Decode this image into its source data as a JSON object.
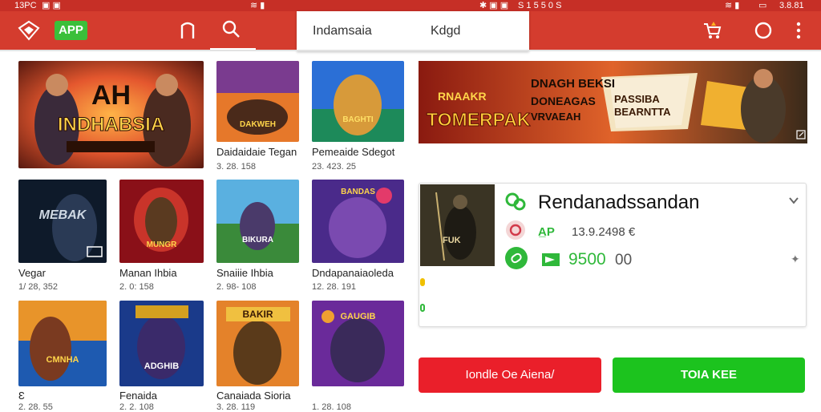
{
  "status_bar": {
    "left_time": "13PC",
    "center_time": "S 1 5 5 0 S",
    "right_time": "3.8.81"
  },
  "app_bar": {
    "app_badge": "APP",
    "menu": {
      "option_primary": "Indamsaia",
      "option_secondary": "Kdgd"
    }
  },
  "featured": {
    "title_line1": "AH",
    "title_line2": "INDHABSIA"
  },
  "grid": [
    {
      "title": "Daidaidaie Tegan",
      "meta": "3. 28. 158",
      "art_text": "DAKWEH"
    },
    {
      "title": "Pemeaide Sdegot",
      "meta": "23. 423. 25",
      "art_text": "BAGHTI"
    },
    {
      "title": "Vegar",
      "meta": "1/ 28, 352",
      "art_text": "MEBAK"
    },
    {
      "title": "Manan Ihbia",
      "meta": "2. 0: 158",
      "art_text": "MUNGR"
    },
    {
      "title": "Snaiiie Ihbia",
      "meta": "2. 98- 108",
      "art_text": "BIKURA"
    },
    {
      "title": "Dndapanaiaoleda",
      "meta": "12. 28. 191",
      "art_text": "BANDAS"
    },
    {
      "title": "Ɛ",
      "meta": "2. 28. 55",
      "art_text": "CMNHA"
    },
    {
      "title": "Fenaida",
      "meta": "2. 2. 108",
      "art_text": "ADGHIB"
    },
    {
      "title": "Canaiada Sioria",
      "meta": "3. 28. 119",
      "art_text": "BAKIR"
    },
    {
      "title": "",
      "meta": "1. 28. 108",
      "art_text": "GAUGIB"
    }
  ],
  "banner": {
    "left_text": "TOMERPAK",
    "left_subtext": "RNAAKR",
    "center_line1": "DNAGH BEKSI",
    "center_line2": "DONEAGAS",
    "center_line3": "VRVAEAH",
    "right_line1": "PASSIBA",
    "right_line2": "BEARNTTA"
  },
  "detail": {
    "thumb_label": "FUK",
    "title": "Rendanadssandan",
    "row1_tag": "A̲P",
    "row1_value": "13.9.2498 €",
    "row2_value": "9500",
    "row2_suffix": "00"
  },
  "actions": {
    "left_label": "Iondle Oe Aiena/",
    "right_label": "TOIA KEE"
  },
  "colors": {
    "app_bar": "#d43c2e",
    "app_badge": "#3bbf3a",
    "button_red": "#ea1f2a",
    "button_green": "#1cc31e"
  }
}
